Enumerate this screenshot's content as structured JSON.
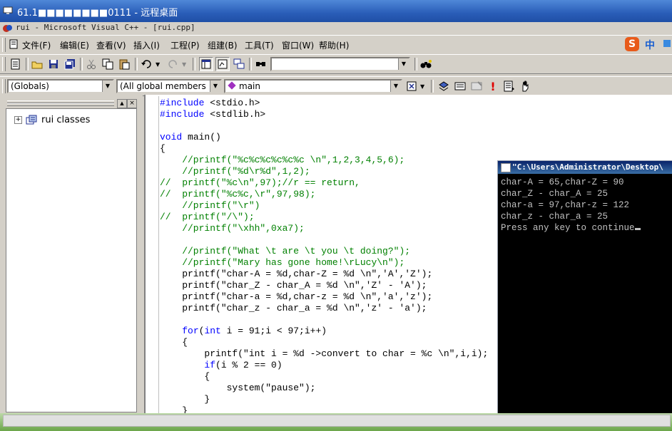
{
  "remote_desktop": {
    "title": "61.1■■■■■■■■0111 - 远程桌面"
  },
  "app": {
    "title": "rui - Microsoft Visual C++ - [rui.cpp]"
  },
  "menu": [
    {
      "label": "文件(F)"
    },
    {
      "label": "编辑(E)"
    },
    {
      "label": "查看(V)"
    },
    {
      "label": "插入(I)"
    },
    {
      "label": "工程(P)"
    },
    {
      "label": "组建(B)"
    },
    {
      "label": "工具(T)"
    },
    {
      "label": "窗口(W)"
    },
    {
      "label": "帮助(H)"
    }
  ],
  "ime": {
    "badge": "S",
    "mode": "中"
  },
  "toolbar2": {
    "globals": "(Globals)",
    "members": "(All global members",
    "function": "main"
  },
  "workspace": {
    "tree_root": "rui classes"
  },
  "code_lines": [
    {
      "parts": [
        {
          "t": "#include",
          "c": "kw"
        },
        {
          "t": " <stdio.h>",
          "c": "pl"
        }
      ]
    },
    {
      "parts": [
        {
          "t": "#include",
          "c": "kw"
        },
        {
          "t": " <stdlib.h>",
          "c": "pl"
        }
      ]
    },
    {
      "parts": []
    },
    {
      "parts": [
        {
          "t": "void",
          "c": "kw"
        },
        {
          "t": " main()",
          "c": "pl"
        }
      ]
    },
    {
      "parts": [
        {
          "t": "{",
          "c": "pl"
        }
      ]
    },
    {
      "parts": [
        {
          "t": "    //printf(\"%c%c%c%c%c%c \\n\",1,2,3,4,5,6);",
          "c": "cm"
        }
      ]
    },
    {
      "parts": [
        {
          "t": "    //printf(\"%d\\r%d\",1,2);",
          "c": "cm"
        }
      ]
    },
    {
      "parts": [
        {
          "t": "//  printf(\"%c\\n\",97);//r == return,",
          "c": "cm"
        }
      ]
    },
    {
      "parts": [
        {
          "t": "//  printf(\"%c%c,\\r\",97,98);",
          "c": "cm"
        }
      ]
    },
    {
      "parts": [
        {
          "t": "    //printf(\"\\r\")",
          "c": "cm"
        }
      ]
    },
    {
      "parts": [
        {
          "t": "//  printf(\"/\\\");",
          "c": "cm"
        }
      ]
    },
    {
      "parts": [
        {
          "t": "    //printf(\"\\xhh\",0xa7);",
          "c": "cm"
        }
      ]
    },
    {
      "parts": []
    },
    {
      "parts": [
        {
          "t": "    //printf(\"What \\t are \\t you \\t doing?\");",
          "c": "cm"
        }
      ]
    },
    {
      "parts": [
        {
          "t": "    //printf(\"Mary has gone home!\\rLucy\\n\");",
          "c": "cm"
        }
      ]
    },
    {
      "parts": [
        {
          "t": "    printf(\"char-A = %d,char-Z = %d \\n\",'A','Z');",
          "c": "pl"
        }
      ]
    },
    {
      "parts": [
        {
          "t": "    printf(\"char_Z - char_A = %d \\n\",'Z' - 'A');",
          "c": "pl"
        }
      ]
    },
    {
      "parts": [
        {
          "t": "    printf(\"char-a = %d,char-z = %d \\n\",'a','z');",
          "c": "pl"
        }
      ]
    },
    {
      "parts": [
        {
          "t": "    printf(\"char_z - char_a = %d \\n\",'z' - 'a');",
          "c": "pl"
        }
      ]
    },
    {
      "parts": []
    },
    {
      "parts": [
        {
          "t": "    ",
          "c": "pl"
        },
        {
          "t": "for",
          "c": "kw"
        },
        {
          "t": "(",
          "c": "pl"
        },
        {
          "t": "int",
          "c": "kw"
        },
        {
          "t": " i = 91;i < 97;i++)",
          "c": "pl"
        }
      ]
    },
    {
      "parts": [
        {
          "t": "    {",
          "c": "pl"
        }
      ]
    },
    {
      "parts": [
        {
          "t": "        printf(\"int i = %d ->convert to char = %c \\n\",i,i);",
          "c": "pl"
        }
      ]
    },
    {
      "parts": [
        {
          "t": "        ",
          "c": "pl"
        },
        {
          "t": "if",
          "c": "kw"
        },
        {
          "t": "(i % 2 == 0)",
          "c": "pl"
        }
      ]
    },
    {
      "parts": [
        {
          "t": "        {",
          "c": "pl"
        }
      ]
    },
    {
      "parts": [
        {
          "t": "            system(\"pause\");",
          "c": "pl"
        }
      ]
    },
    {
      "parts": [
        {
          "t": "        }",
          "c": "pl"
        }
      ]
    },
    {
      "parts": [
        {
          "t": "    }",
          "c": "pl"
        }
      ]
    }
  ],
  "console": {
    "title": "\"C:\\Users\\Administrator\\Desktop\\",
    "lines": [
      "char-A = 65,char-Z = 90",
      "char_Z - char_A = 25",
      "char-a = 97,char-z = 122",
      "char_z - char_a = 25",
      "Press any key to continue"
    ]
  },
  "colors": {
    "keyword": "#0000ff",
    "comment": "#008000",
    "titlebar": "#2a5db8",
    "console_bg": "#000000"
  }
}
